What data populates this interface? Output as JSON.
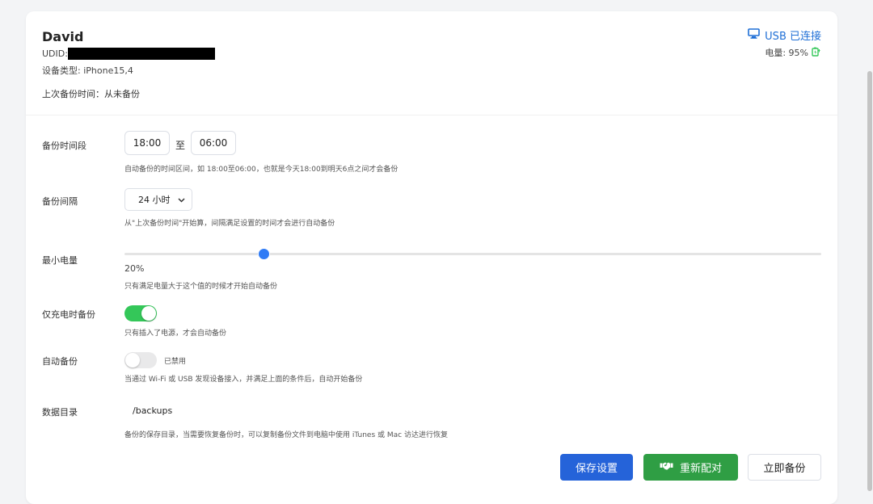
{
  "device": {
    "name": "David",
    "udid_label": "UDID:",
    "type_label": "设备类型: iPhone15,4",
    "last_backup_label": "上次备份时间：从未备份"
  },
  "status": {
    "usb": "USB 已连接",
    "battery": "电量: 95%",
    "accent_color": "#1f6fd6",
    "battery_icon_color": "#34c759"
  },
  "settings": {
    "time_range": {
      "label": "备份时间段",
      "start": "18:00",
      "separator": "至",
      "end": "06:00",
      "hint": "自动备份的时间区间，如 18:00至06:00，也就是今天18:00到明天6点之间才会备份"
    },
    "interval": {
      "label": "备份间隔",
      "value": "24 小时",
      "hint": "从\"上次备份时间\"开始算，间隔满足设置的时间才会进行自动备份"
    },
    "min_battery": {
      "label": "最小电量",
      "value_text": "20%",
      "value": 20,
      "hint": "只有满足电量大于这个值的时候才开始自动备份"
    },
    "charging_only": {
      "label": "仅充电时备份",
      "enabled": true,
      "hint": "只有插入了电源，才会自动备份"
    },
    "auto_backup": {
      "label": "自动备份",
      "enabled": false,
      "state_text": "已禁用",
      "hint": "当通过 Wi-Fi 或 USB 发现设备接入，并满足上面的条件后，自动开始备份"
    },
    "data_dir": {
      "label": "数据目录",
      "value": "/backups",
      "hint": "备份的保存目录，当需要恢复备份时，可以复制备份文件到电脑中使用 iTunes 或 Mac 访达进行恢复"
    }
  },
  "buttons": {
    "save": "保存设置",
    "repair": "重新配对",
    "backup_now": "立即备份"
  }
}
